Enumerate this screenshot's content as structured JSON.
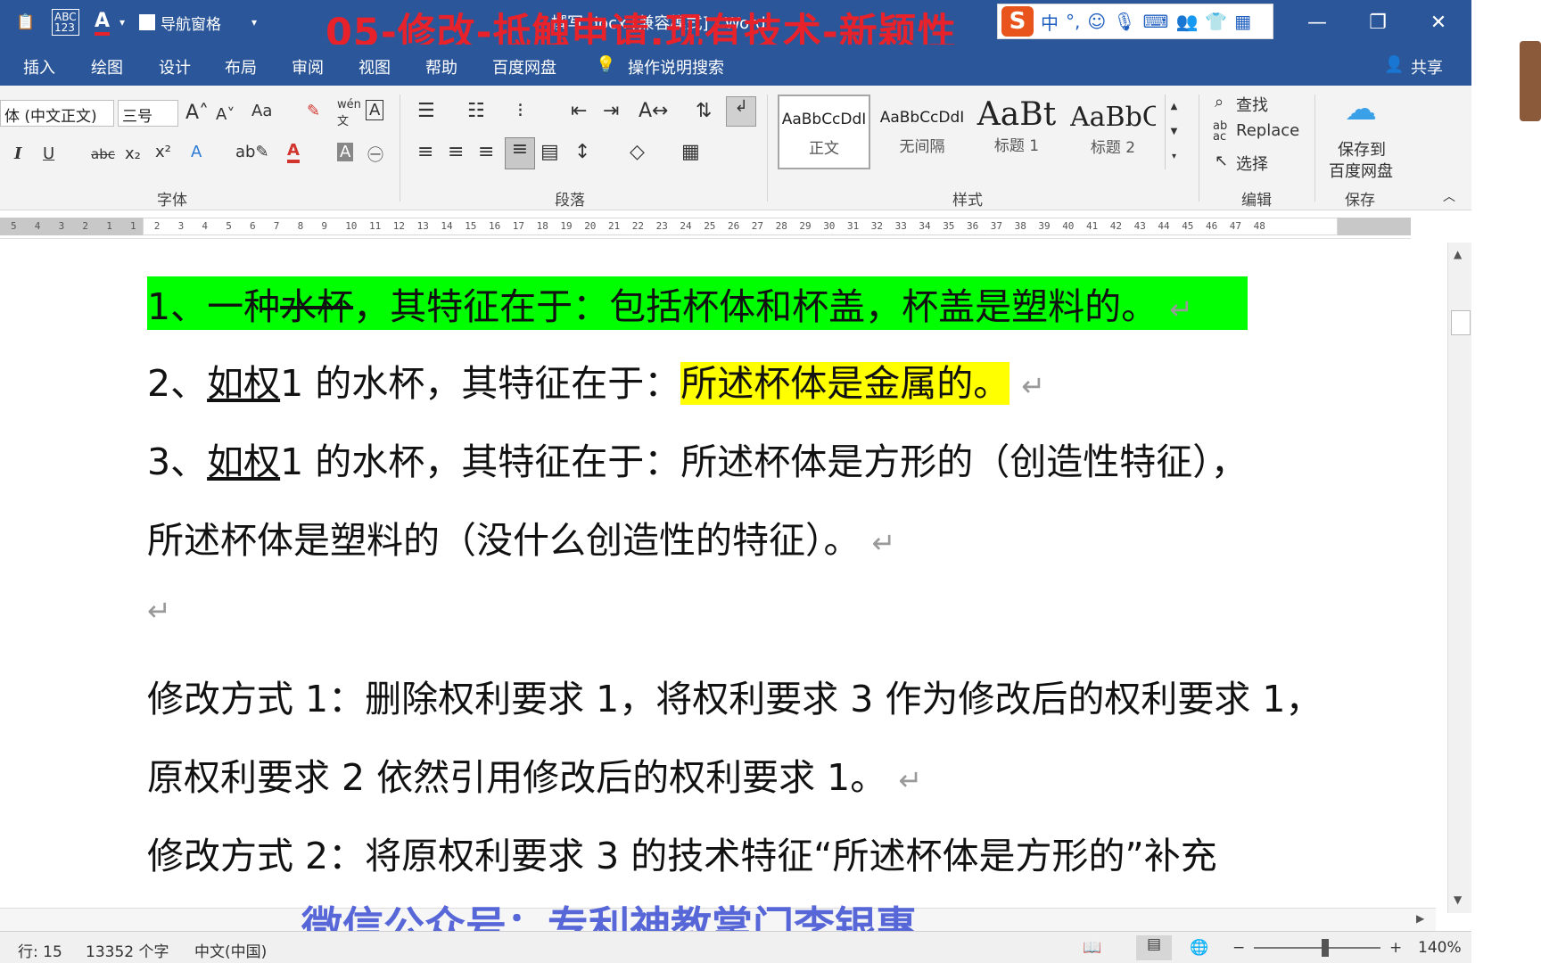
{
  "titlebar": {
    "overlay_title": "05-修改-抵触申请,现有技术-新颖性",
    "doc_title": "撰写.docx [兼容模式] - Word",
    "nav_pane_label": "导航窗格",
    "ime_lang": "中",
    "ime_punct": "°,",
    "minimize": "—",
    "restore": "❐",
    "close": "✕"
  },
  "tabs": [
    "插入",
    "绘图",
    "设计",
    "布局",
    "审阅",
    "视图",
    "帮助",
    "百度网盘",
    "操作说明搜索"
  ],
  "share_label": "共享",
  "ribbon": {
    "font_name": "体 (中文正文)",
    "font_size": "三号",
    "change_case": "Aa",
    "group_font": "字体",
    "group_paragraph": "段落",
    "group_styles": "样式",
    "group_editing": "编辑",
    "group_save": "保存",
    "styles": [
      {
        "sample": "AaBbCcDdI",
        "name": "正文"
      },
      {
        "sample": "AaBbCcDdI",
        "name": "无间隔"
      },
      {
        "sample": "AaBt",
        "name": "标题 1"
      },
      {
        "sample": "AaBbC",
        "name": "标题 2"
      }
    ],
    "find": "查找",
    "replace": "Replace",
    "select": "选择",
    "save_to_baidu_line1": "保存到",
    "save_to_baidu_line2": "百度网盘"
  },
  "ruler_numbers": [
    "5",
    "4",
    "3",
    "2",
    "1",
    "1",
    "2",
    "3",
    "4",
    "5",
    "6",
    "7",
    "8",
    "9",
    "10",
    "11",
    "12",
    "13",
    "14",
    "15",
    "16",
    "17",
    "18",
    "19",
    "20",
    "21",
    "22",
    "23",
    "24",
    "25",
    "26",
    "27",
    "28",
    "29",
    "30",
    "31",
    "32",
    "33",
    "34",
    "35",
    "36",
    "37",
    "38",
    "39",
    "40",
    "41",
    "42",
    "43",
    "44",
    "45",
    "46",
    "47",
    "48"
  ],
  "document": {
    "p1_a": "1、一种",
    "p1_strike": "水杯",
    "p1_b": "，其特征在于：包括杯体和杯盖，杯盖是塑料的。",
    "p2_a": "2、",
    "p2_u": "如权",
    "p2_b": "1 的水杯，其特征在于：",
    "p2_hl": "所述杯体是金属的。",
    "p3_a": "3、",
    "p3_u": "如权",
    "p3_b": "1 的水杯，其特征在于：所述杯体是方形的（创造性特征），",
    "p4": "所述杯体是塑料的（没什么创造性的特征）。",
    "p6": "修改方式 1：删除权利要求 1，将权利要求 3 作为修改后的权利要求 1，",
    "p7": "原权利要求 2 依然引用修改后的权利要求 1。",
    "p8": "修改方式 2：将原权利要求 3 的技术特征“所述杯体是方形的”补充",
    "para_mark": "↵"
  },
  "watermark": "微信公众号：专利神教掌门李银惠",
  "status": {
    "line": "行: 15",
    "words": "13352 个字",
    "language": "中文(中国)",
    "zoom": "140%"
  },
  "colors": {
    "title_blue": "#2b579a",
    "overlay_red": "#e8222a",
    "highlight_green": "#00ff00",
    "highlight_yellow": "#ffff00",
    "watermark_blue": "#4a5bd6"
  }
}
